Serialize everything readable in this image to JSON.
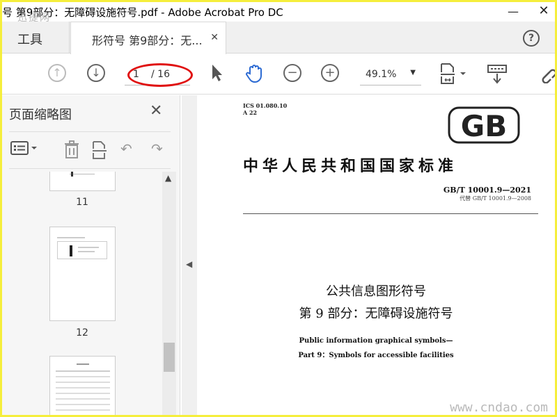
{
  "window": {
    "title": "号 第9部分：无障碍设施符号.pdf - Adobe Acrobat Pro DC",
    "watermark": "迅捷网"
  },
  "tabs": {
    "tools_label": "工具",
    "doc_label": "形符号 第9部分：无..."
  },
  "toolbar": {
    "current_page": "1",
    "total_pages": "/ 16",
    "zoom": "49.1%"
  },
  "sidebar": {
    "title": "页面缩略图",
    "thumb_labels": [
      "11",
      "12"
    ]
  },
  "document": {
    "ics": "ICS  01.080.10",
    "ccs": "A  22",
    "logo": "GB",
    "heading": "中华人民共和国国家标准",
    "std_number": "GB/T  10001.9—2021",
    "replaces": "代替 GB/T 10001.9—2008",
    "title_cn_1": "公共信息图形符号",
    "title_cn_2": "第 9 部分：无障碍设施符号",
    "title_en_1": "Public information graphical symbols—",
    "title_en_2": "Part 9：Symbols for accessible facilities"
  },
  "footer_watermark": "www.cndao.com",
  "colors": {
    "frame": "#f5ee3c",
    "accent_blue": "#2d6bd3",
    "annotation_red": "#e01010"
  }
}
